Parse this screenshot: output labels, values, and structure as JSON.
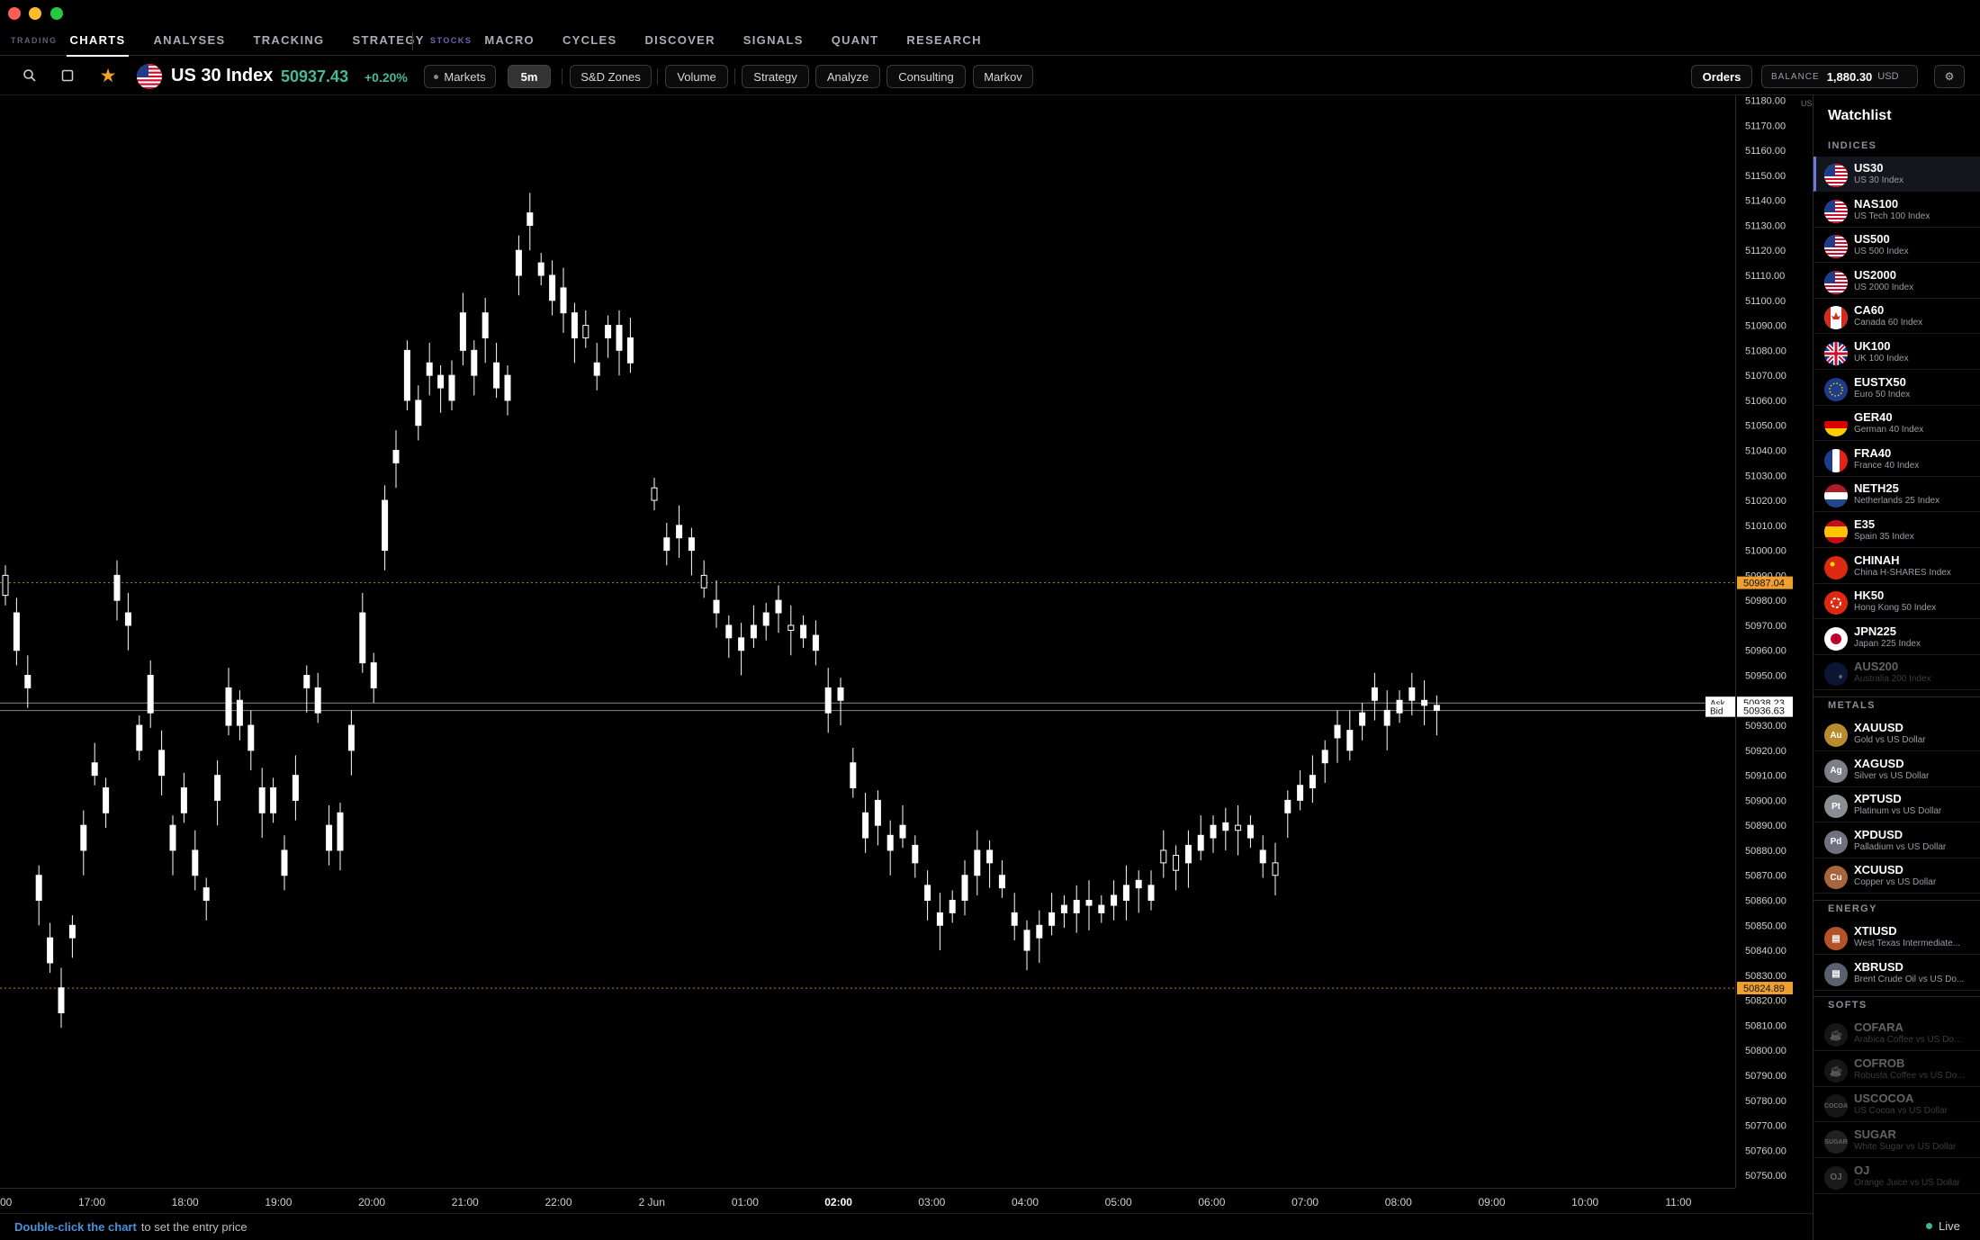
{
  "nav": {
    "sections": {
      "trading": "TRADING",
      "stocks": "STOCKS"
    },
    "tabs": [
      {
        "label": "CHARTS",
        "active": true
      },
      {
        "label": "ANALYSES"
      },
      {
        "label": "TRACKING"
      },
      {
        "label": "STRATEGY"
      },
      {
        "label": "MACRO"
      },
      {
        "label": "CYCLES"
      },
      {
        "label": "DISCOVER"
      },
      {
        "label": "SIGNALS"
      },
      {
        "label": "QUANT"
      },
      {
        "label": "RESEARCH"
      }
    ]
  },
  "toolbar": {
    "symbol_name": "US 30 Index",
    "price": "50937.43",
    "change": "+0.20%",
    "markets_label": "Markets",
    "timeframe": "5m",
    "buttons": [
      "S&D Zones",
      "Volume",
      "Strategy",
      "Analyze",
      "Consulting",
      "Markov"
    ],
    "orders_label": "Orders",
    "balance_label": "BALANCE",
    "balance_value": "1,880.30",
    "balance_currency": "USD",
    "icons": [
      "search-icon",
      "square-icon",
      "star-icon",
      "settings-icon"
    ]
  },
  "chart_data": {
    "type": "candlestick",
    "symbol": "US30",
    "timeframe": "5m",
    "ylim": [
      50745,
      51182
    ],
    "y_tick_step": 10,
    "y_tick_first": 50750,
    "y_tick_last": 51180,
    "x_ticks": [
      "00",
      "17:00",
      "18:00",
      "19:00",
      "20:00",
      "21:00",
      "22:00",
      "2 Jun",
      "01:00",
      "02:00",
      "03:00",
      "04:00",
      "05:00",
      "06:00",
      "07:00",
      "08:00",
      "09:00",
      "10:00",
      "11:00"
    ],
    "x_tick_bold": "02:00",
    "axis_unit_label": "USD",
    "levels": [
      {
        "name": "upper-level",
        "value": 50987.04,
        "label": "50987.04",
        "color": "#f0a030"
      },
      {
        "name": "lower-level",
        "value": 50824.89,
        "label": "50824.89",
        "color": "#f0a030"
      }
    ],
    "ask": {
      "label": "Ask",
      "value": 50938.23,
      "text": "50938.23"
    },
    "bid": {
      "label": "Bid",
      "value": 50936.63,
      "text": "50936.63"
    },
    "segments": [
      {
        "name": "session-1",
        "path": [
          [
            50990,
            50982
          ],
          [
            50960,
            50975
          ],
          [
            50945,
            50950
          ],
          [
            50860,
            50870
          ],
          [
            50835,
            50845
          ],
          [
            50815,
            50825
          ],
          [
            50845,
            50850
          ],
          [
            50880,
            50890
          ],
          [
            50910,
            50915
          ],
          [
            50895,
            50905
          ],
          [
            50980,
            50990
          ],
          [
            50970,
            50975
          ],
          [
            50920,
            50930
          ],
          [
            50935,
            50950
          ],
          [
            50910,
            50920
          ],
          [
            50880,
            50890
          ],
          [
            50895,
            50905
          ],
          [
            50870,
            50880
          ],
          [
            50860,
            50865
          ],
          [
            50900,
            50910
          ],
          [
            50930,
            50945
          ],
          [
            50930,
            50940
          ],
          [
            50920,
            50930
          ],
          [
            50895,
            50905
          ],
          [
            50895,
            50905
          ],
          [
            50870,
            50880
          ],
          [
            50900,
            50910
          ],
          [
            50945,
            50950
          ],
          [
            50935,
            50945
          ],
          [
            50880,
            50890
          ],
          [
            50880,
            50895
          ],
          [
            50920,
            50930
          ],
          [
            50955,
            50975
          ],
          [
            50945,
            50955
          ],
          [
            51000,
            51020
          ],
          [
            51035,
            51040
          ],
          [
            51060,
            51080
          ],
          [
            51050,
            51060
          ],
          [
            51070,
            51075
          ],
          [
            51065,
            51070
          ],
          [
            51060,
            51070
          ],
          [
            51080,
            51095
          ],
          [
            51070,
            51080
          ],
          [
            51085,
            51095
          ],
          [
            51065,
            51075
          ],
          [
            51060,
            51070
          ],
          [
            51110,
            51120
          ],
          [
            51130,
            51135
          ],
          [
            51110,
            51115
          ],
          [
            51100,
            51110
          ],
          [
            51095,
            51105
          ],
          [
            51085,
            51095
          ],
          [
            51090,
            51085
          ],
          [
            51070,
            51075
          ],
          [
            51085,
            51090
          ],
          [
            51080,
            51090
          ],
          [
            51075,
            51085
          ]
        ]
      },
      {
        "name": "session-2",
        "path": [
          [
            51025,
            51020
          ],
          [
            51000,
            51005
          ],
          [
            51005,
            51010
          ],
          [
            51000,
            51005
          ],
          [
            50990,
            50985
          ],
          [
            50975,
            50980
          ],
          [
            50965,
            50970
          ],
          [
            50960,
            50965
          ],
          [
            50965,
            50970
          ],
          [
            50970,
            50975
          ],
          [
            50975,
            50980
          ],
          [
            50970,
            50968
          ],
          [
            50965,
            50970
          ],
          [
            50960,
            50966
          ],
          [
            50935,
            50945
          ],
          [
            50940,
            50945
          ],
          [
            50905,
            50915
          ],
          [
            50885,
            50895
          ],
          [
            50890,
            50900
          ],
          [
            50880,
            50886
          ],
          [
            50885,
            50890
          ],
          [
            50875,
            50882
          ],
          [
            50860,
            50866
          ],
          [
            50850,
            50855
          ],
          [
            50855,
            50860
          ],
          [
            50860,
            50870
          ],
          [
            50870,
            50880
          ],
          [
            50875,
            50880
          ],
          [
            50865,
            50870
          ],
          [
            50850,
            50855
          ],
          [
            50840,
            50848
          ],
          [
            50845,
            50850
          ],
          [
            50850,
            50855
          ],
          [
            50855,
            50858
          ],
          [
            50855,
            50860
          ],
          [
            50858,
            50860
          ],
          [
            50855,
            50858
          ],
          [
            50858,
            50862
          ],
          [
            50860,
            50866
          ],
          [
            50865,
            50868
          ],
          [
            50860,
            50866
          ],
          [
            50880,
            50875
          ],
          [
            50878,
            50872
          ],
          [
            50875,
            50882
          ],
          [
            50880,
            50886
          ],
          [
            50885,
            50890
          ],
          [
            50888,
            50891
          ],
          [
            50890,
            50888
          ],
          [
            50885,
            50890
          ],
          [
            50875,
            50880
          ],
          [
            50875,
            50870
          ],
          [
            50895,
            50900
          ],
          [
            50900,
            50906
          ],
          [
            50905,
            50910
          ],
          [
            50915,
            50920
          ],
          [
            50925,
            50930
          ],
          [
            50920,
            50928
          ],
          [
            50930,
            50935
          ],
          [
            50940,
            50945
          ],
          [
            50930,
            50936
          ],
          [
            50935,
            50940
          ],
          [
            50940,
            50945
          ],
          [
            50938,
            50940
          ],
          [
            50936,
            50938
          ]
        ]
      }
    ]
  },
  "watchlist": {
    "title": "Watchlist",
    "sections": [
      {
        "title": "INDICES",
        "items": [
          {
            "sym": "US30",
            "desc": "US 30 Index",
            "flag": "us",
            "active": true
          },
          {
            "sym": "NAS100",
            "desc": "US Tech 100 Index",
            "flag": "us"
          },
          {
            "sym": "US500",
            "desc": "US 500 Index",
            "flag": "us"
          },
          {
            "sym": "US2000",
            "desc": "US 2000 Index",
            "flag": "us"
          },
          {
            "sym": "CA60",
            "desc": "Canada 60 Index",
            "flag": "ca"
          },
          {
            "sym": "UK100",
            "desc": "UK 100 Index",
            "flag": "uk"
          },
          {
            "sym": "EUSTX50",
            "desc": "Euro 50 Index",
            "flag": "eu"
          },
          {
            "sym": "GER40",
            "desc": "German 40 Index",
            "flag": "de"
          },
          {
            "sym": "FRA40",
            "desc": "France 40 Index",
            "flag": "fr"
          },
          {
            "sym": "NETH25",
            "desc": "Netherlands 25 Index",
            "flag": "nl"
          },
          {
            "sym": "E35",
            "desc": "Spain 35 Index",
            "flag": "es"
          },
          {
            "sym": "CHINAH",
            "desc": "China H-SHARES Index",
            "flag": "cn"
          },
          {
            "sym": "HK50",
            "desc": "Hong Kong 50 Index",
            "flag": "hk"
          },
          {
            "sym": "JPN225",
            "desc": "Japan 225 Index",
            "flag": "jp"
          },
          {
            "sym": "AUS200",
            "desc": "Australia 200 Index",
            "flag": "au",
            "dim": true
          }
        ]
      },
      {
        "title": "METALS",
        "items": [
          {
            "sym": "XAUUSD",
            "desc": "Gold vs US Dollar",
            "badge": "Au",
            "color": "#b98a2e"
          },
          {
            "sym": "XAGUSD",
            "desc": "Silver vs US Dollar",
            "badge": "Ag",
            "color": "#7d7f86"
          },
          {
            "sym": "XPTUSD",
            "desc": "Platinum vs US Dollar",
            "badge": "Pt",
            "color": "#8b8d95"
          },
          {
            "sym": "XPDUSD",
            "desc": "Palladium vs US Dollar",
            "badge": "Pd",
            "color": "#6f7180"
          },
          {
            "sym": "XCUUSD",
            "desc": "Copper vs US Dollar",
            "badge": "Cu",
            "color": "#a8643a"
          }
        ]
      },
      {
        "title": "ENERGY",
        "items": [
          {
            "sym": "XTIUSD",
            "desc": "West Texas Intermediate...",
            "badge": "barrel",
            "color": "#b5522a"
          },
          {
            "sym": "XBRUSD",
            "desc": "Brent Crude Oil vs US Do...",
            "badge": "barrel",
            "color": "#5a6070"
          }
        ]
      },
      {
        "title": "SOFTS",
        "items": [
          {
            "sym": "COFARA",
            "desc": "Arabica Coffee vs US Do...",
            "badge": "cup",
            "color": "#3a3a3a",
            "dim": true
          },
          {
            "sym": "COFROB",
            "desc": "Robusta Coffee vs US Do...",
            "badge": "cup",
            "color": "#3a3a3a",
            "dim": true
          },
          {
            "sym": "USCOCOA",
            "desc": "US Cocoa vs US Dollar",
            "badge": "COCOA",
            "color": "#3a3a3a",
            "dim": true
          },
          {
            "sym": "SUGAR",
            "desc": "White Sugar vs US Dollar",
            "badge": "SUGAR",
            "color": "#555",
            "dim": true
          },
          {
            "sym": "OJ",
            "desc": "Orange Juice vs US Dollar",
            "badge": "OJ",
            "color": "#444",
            "dim": true
          }
        ]
      }
    ]
  },
  "status": {
    "hint_bold": "Double-click the chart",
    "hint_rest": "to set the entry price",
    "live_label": "Live",
    "live_color": "#3fb68b"
  },
  "colors": {
    "accent": "#6b7bd6",
    "up": "#48b89a",
    "level": "#f0a030"
  }
}
